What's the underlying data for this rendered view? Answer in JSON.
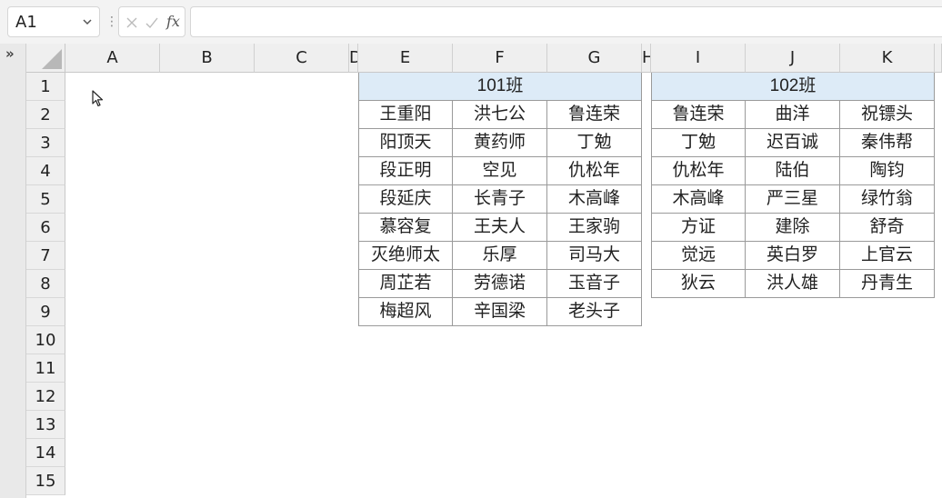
{
  "formula_bar": {
    "name_box": "A1",
    "fx_label": "fx",
    "formula_value": ""
  },
  "icons": {
    "collapse": "double-chevron-right-icon",
    "dropdown": "chevron-down-icon",
    "cancel": "cross-icon",
    "confirm": "check-icon"
  },
  "columns": [
    "A",
    "B",
    "C",
    "D",
    "E",
    "F",
    "G",
    "H",
    "I",
    "J",
    "K"
  ],
  "rows": [
    "1",
    "2",
    "3",
    "4",
    "5",
    "6",
    "7",
    "8",
    "9",
    "10",
    "11",
    "12",
    "13",
    "14",
    "15"
  ],
  "class_101": {
    "title": "101班",
    "rows": [
      [
        "王重阳",
        "洪七公",
        "鲁连荣"
      ],
      [
        "阳顶天",
        "黄药师",
        "丁勉"
      ],
      [
        "段正明",
        "空见",
        "仇松年"
      ],
      [
        "段延庆",
        "长青子",
        "木高峰"
      ],
      [
        "慕容复",
        "王夫人",
        "王家驹"
      ],
      [
        "灭绝师太",
        "乐厚",
        "司马大"
      ],
      [
        "周芷若",
        "劳德诺",
        "玉音子"
      ],
      [
        "梅超风",
        "辛国梁",
        "老头子"
      ]
    ]
  },
  "class_102": {
    "title": "102班",
    "rows": [
      [
        "鲁连荣",
        "曲洋",
        "祝镖头"
      ],
      [
        "丁勉",
        "迟百诚",
        "秦伟帮"
      ],
      [
        "仇松年",
        "陆伯",
        "陶钧"
      ],
      [
        "木高峰",
        "严三星",
        "绿竹翁"
      ],
      [
        "方证",
        "建除",
        "舒奇"
      ],
      [
        "觉远",
        "英白罗",
        "上官云"
      ],
      [
        "狄云",
        "洪人雄",
        "丹青生"
      ]
    ]
  },
  "colors": {
    "header_fill": "#ddebf7",
    "grid_header_bg": "#efefef",
    "border": "#9a9a9a"
  }
}
